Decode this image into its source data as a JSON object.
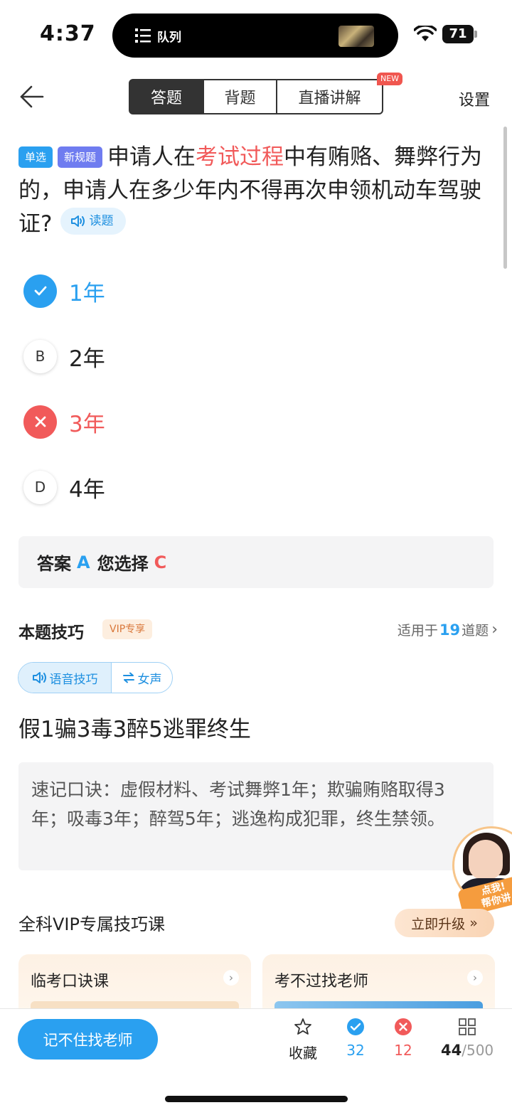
{
  "status_bar": {
    "time": "4:37",
    "now_playing": "队列",
    "battery": "71"
  },
  "nav": {
    "tabs": [
      {
        "label": "答题",
        "active": true
      },
      {
        "label": "背题",
        "active": false
      },
      {
        "label": "直播讲解",
        "active": false
      }
    ],
    "new_badge": "NEW",
    "settings": "设置"
  },
  "question": {
    "tags": [
      "单选",
      "新规题"
    ],
    "text_before": "申请人在",
    "highlight": "考试过程",
    "text_after": "中有贿赂、舞弊行为的，申请人在多少年内不得再次申领机动车驾驶证?",
    "read_label": "读题"
  },
  "options": [
    {
      "letter": "A",
      "text": "1年",
      "state": "correct"
    },
    {
      "letter": "B",
      "text": "2年",
      "state": "normal"
    },
    {
      "letter": "C",
      "text": "3年",
      "state": "wrong"
    },
    {
      "letter": "D",
      "text": "4年",
      "state": "normal"
    }
  ],
  "answer": {
    "answer_label": "答案",
    "answer_value": "A",
    "chosen_label": "您选择",
    "chosen_value": "C"
  },
  "tips": {
    "title": "本题技巧",
    "vip_badge": "VIP专享",
    "applies_prefix": "适用于",
    "applies_count": "19",
    "applies_suffix": "道题",
    "voice_tips": "语音技巧",
    "voice_female": "女声",
    "mnemonic": "假1骗3毒3醉5逃罪终生",
    "explanation": "速记口诀：虚假材料、考试舞弊1年；欺骗贿赂取得3年；吸毒3年；醉驾5年；逃逸构成犯罪，终生禁领。"
  },
  "teacher_float": {
    "label_line1": "点我!",
    "label_line2": "帮你讲"
  },
  "vip_course": {
    "title": "全科VIP专属技巧课",
    "upgrade": "立即升级",
    "cards": [
      {
        "title": "临考口诀课"
      },
      {
        "title": "考不过找老师"
      }
    ]
  },
  "bottom_bar": {
    "ask_teacher": "记不住找老师",
    "favorite": "收藏",
    "correct_count": "32",
    "wrong_count": "12",
    "progress_current": "44",
    "progress_total": "/500"
  },
  "colors": {
    "accent_blue": "#2aa0f0",
    "error_red": "#f15a5a",
    "vip_orange": "#d9773a"
  }
}
